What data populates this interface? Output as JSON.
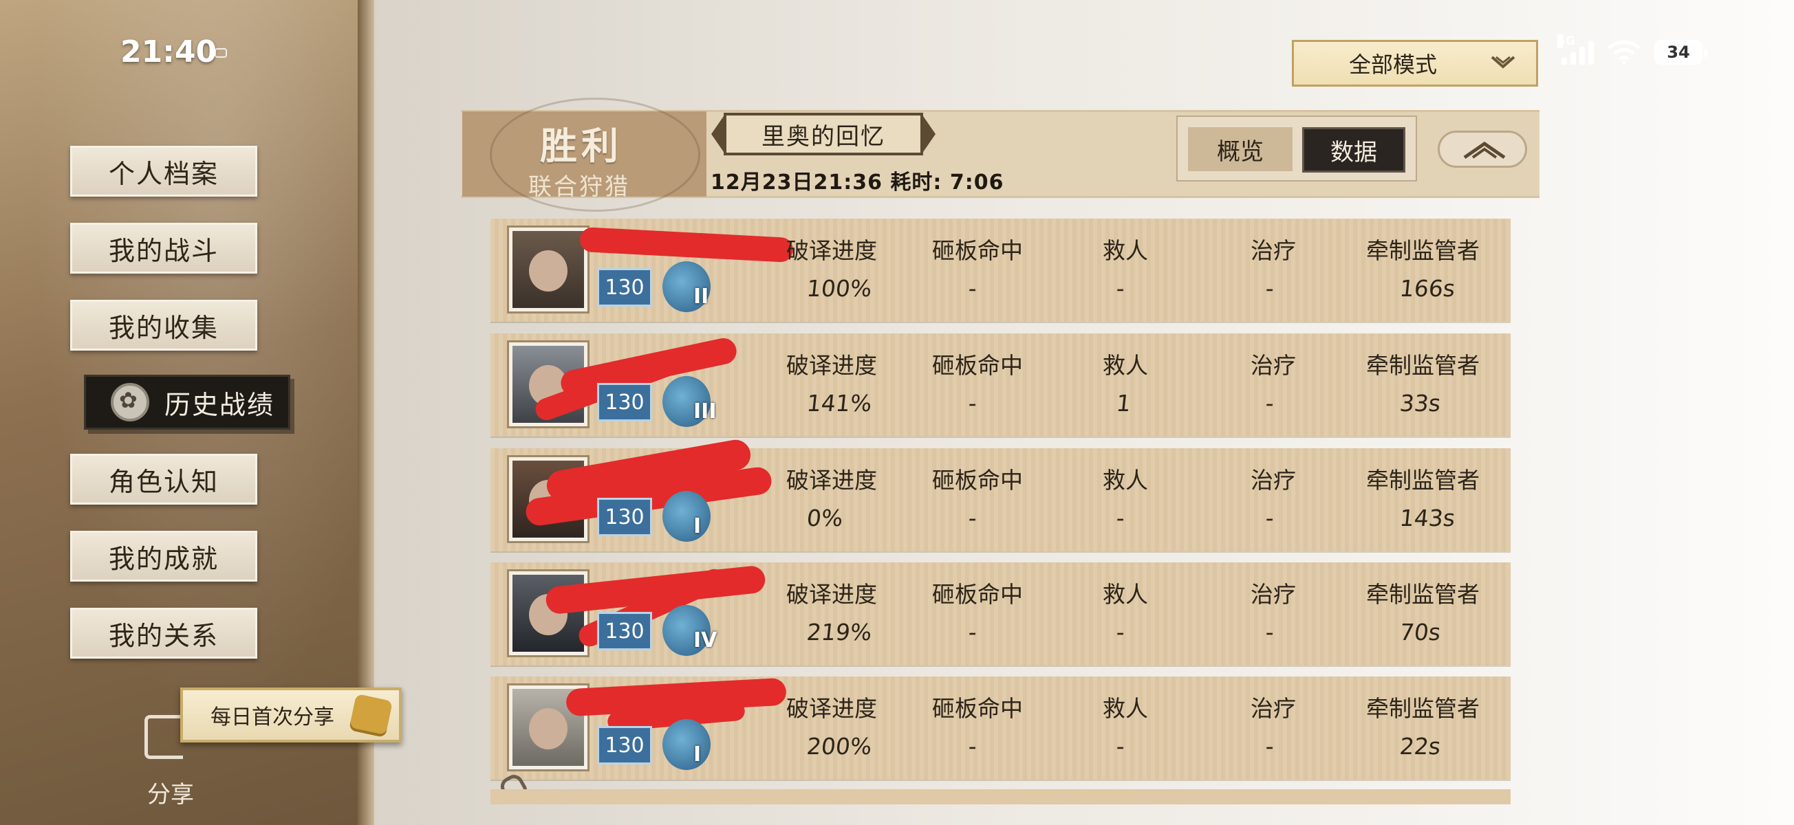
{
  "status_bar": {
    "time": "21:40",
    "network": "5G",
    "battery": "34"
  },
  "sidebar": {
    "items": [
      {
        "label": "个人档案"
      },
      {
        "label": "我的战斗"
      },
      {
        "label": "我的收集"
      },
      {
        "label": "历史战绩",
        "active": true
      },
      {
        "label": "角色认知"
      },
      {
        "label": "我的成就"
      },
      {
        "label": "我的关系"
      }
    ],
    "share_banner": "每日首次分享",
    "share_label": "分享"
  },
  "mode_filter": {
    "selected": "全部模式"
  },
  "match": {
    "result": "胜利",
    "mode": "联合狩猎",
    "map": "里奥的回忆",
    "time_line": "12月23日21:36 耗时: 7:06"
  },
  "tabs": {
    "overview": "概览",
    "data": "数据"
  },
  "stat_headers": [
    "破译进度",
    "砸板命中",
    "救人",
    "治疗",
    "牵制监管者"
  ],
  "players": [
    {
      "level": "130",
      "rank": "II",
      "stats": [
        "100%",
        "-",
        "-",
        "-",
        "166s"
      ]
    },
    {
      "level": "130",
      "rank": "III",
      "stats": [
        "141%",
        "-",
        "1",
        "-",
        "33s"
      ]
    },
    {
      "level": "130",
      "rank": "I",
      "stats": [
        "0%",
        "-",
        "-",
        "-",
        "143s"
      ]
    },
    {
      "level": "130",
      "rank": "IV",
      "stats": [
        "219%",
        "-",
        "-",
        "-",
        "70s"
      ]
    },
    {
      "level": "130",
      "rank": "I",
      "stats": [
        "200%",
        "-",
        "-",
        "-",
        "22s"
      ]
    }
  ],
  "colors": {
    "redaction": "#e32b2b",
    "level_badge": "#3c6f9b",
    "row_bg": "#dfc9a6"
  }
}
